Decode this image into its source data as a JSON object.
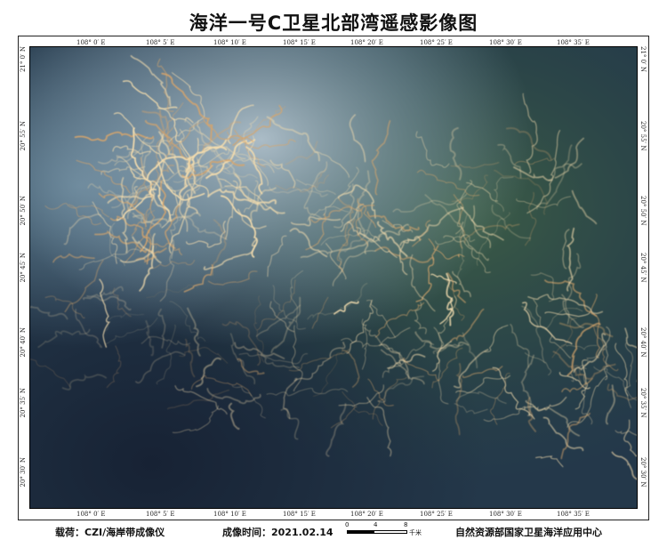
{
  "title": "海洋一号C卫星北部湾遥感影像图",
  "map": {
    "lon_ticks": [
      "108° 0′ E",
      "108° 5′ E",
      "108° 10′ E",
      "108° 15′ E",
      "108° 20′ E",
      "108° 25′ E",
      "108° 30′ E",
      "108° 35′ E"
    ],
    "lat_ticks": [
      "21° 0′ N",
      "20° 55′ N",
      "20° 50′ N",
      "20° 45′ N",
      "20° 40′ N",
      "20° 35′ N",
      "20° 30′ N"
    ],
    "palette": {
      "water_deep": "#1c2a3c",
      "water_mid": "#2d4b4a",
      "haze": "#8fa8b8",
      "glint": "#f3dcae"
    }
  },
  "footer": {
    "payload": "载荷：CZI/海岸带成像仪",
    "acq_time": "成像时间：2021.02.14",
    "scale_labels": [
      "0",
      "4",
      "8"
    ],
    "scale_unit": "千米",
    "organization": "自然资源部国家卫星海洋应用中心"
  }
}
